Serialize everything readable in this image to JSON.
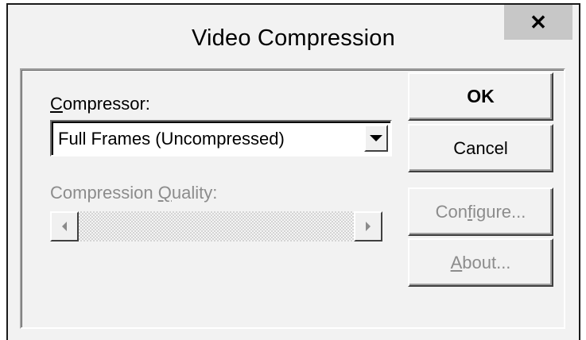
{
  "window": {
    "title": "Video Compression",
    "close_glyph": "✕"
  },
  "compressor": {
    "label_first": "C",
    "label_rest": "ompressor:",
    "selected_value": "Full Frames (Uncompressed)"
  },
  "quality": {
    "label_pre": "Compression ",
    "label_accel": "Q",
    "label_post": "uality:",
    "enabled": false
  },
  "buttons": {
    "ok": "OK",
    "cancel": "Cancel",
    "configure_pre": "Con",
    "configure_accel": "f",
    "configure_post": "igure...",
    "about_accel": "A",
    "about_post": "bout..."
  },
  "icons": {
    "close": "close-icon",
    "dropdown": "chevron-down-icon",
    "scroll_left": "arrow-left-icon",
    "scroll_right": "arrow-right-icon"
  },
  "colors": {
    "dialog_bg": "#f2f2f2",
    "disabled_text": "#8c8c8c",
    "close_bg": "#c7c7c7"
  }
}
